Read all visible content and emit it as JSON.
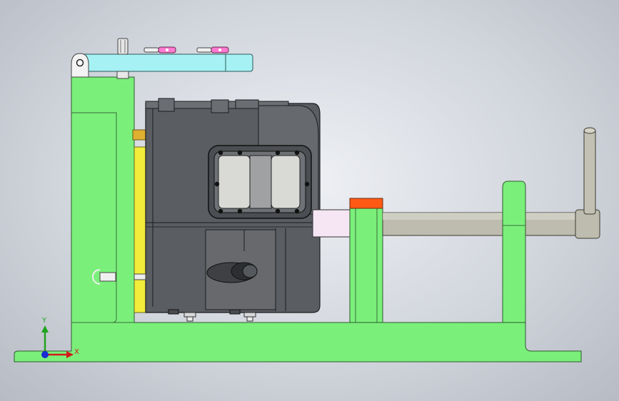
{
  "triad": {
    "x_label": "X",
    "y_label": "Y"
  },
  "colors": {
    "base_green": "#7af07a",
    "clamp_arm": "#a6f1f3",
    "housing_dark": "#5a5d61",
    "shaft_gray": "#b8b6a6",
    "pad_yellow": "#f2ec3a",
    "pad_orange": "#ff5a14",
    "block_pink": "#f6e6f4",
    "screw_pink": "#ff7ad0"
  },
  "icons": [
    "triad-x-arrow",
    "triad-y-arrow",
    "triad-z-origin"
  ]
}
